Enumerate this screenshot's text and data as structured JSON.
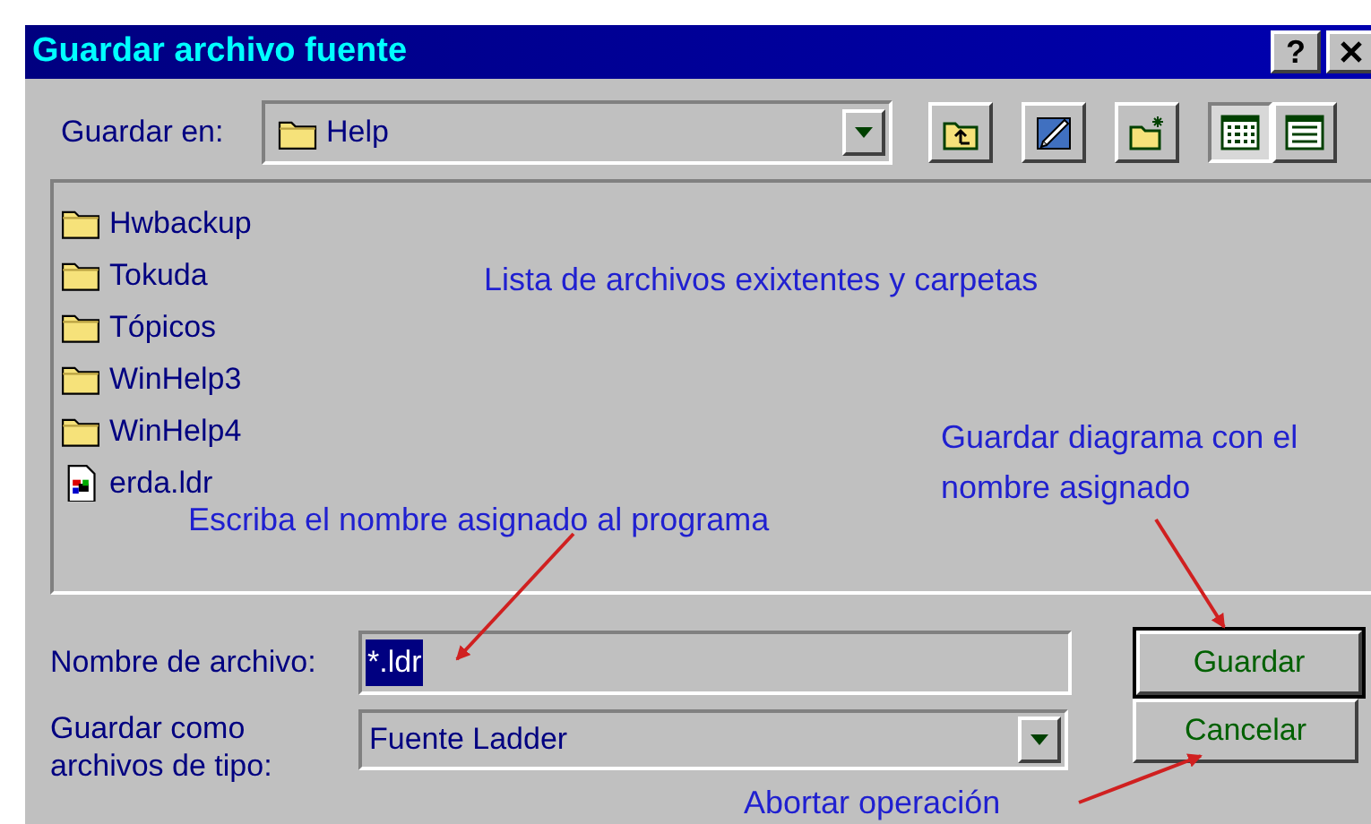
{
  "window": {
    "title": "Guardar archivo fuente",
    "help_button": "?"
  },
  "save_in": {
    "label": "Guardar en:",
    "value": "Help"
  },
  "view_modes": [
    {
      "kind": "list",
      "selected": true
    },
    {
      "kind": "details",
      "selected": false
    }
  ],
  "files": [
    {
      "name": "Hwbackup",
      "kind": "folder"
    },
    {
      "name": "Tokuda",
      "kind": "folder"
    },
    {
      "name": "Tópicos",
      "kind": "folder"
    },
    {
      "name": "WinHelp3",
      "kind": "folder"
    },
    {
      "name": "WinHelp4",
      "kind": "folder"
    },
    {
      "name": "erda.ldr",
      "kind": "file"
    }
  ],
  "file_name": {
    "label": "Nombre de archivo:",
    "value": "*.ldr",
    "selected": true
  },
  "file_type": {
    "label": "Guardar como archivos de tipo:",
    "value": "Fuente Ladder"
  },
  "buttons": [
    {
      "label": "Guardar",
      "default": true
    },
    {
      "label": "Cancelar",
      "default": false
    }
  ],
  "annotations": [
    "Lista de archivos exixtentes y carpetas",
    "Guardar diagrama con el nombre asignado",
    "Escriba el nombre asignado al programa",
    "Abortar operación"
  ]
}
